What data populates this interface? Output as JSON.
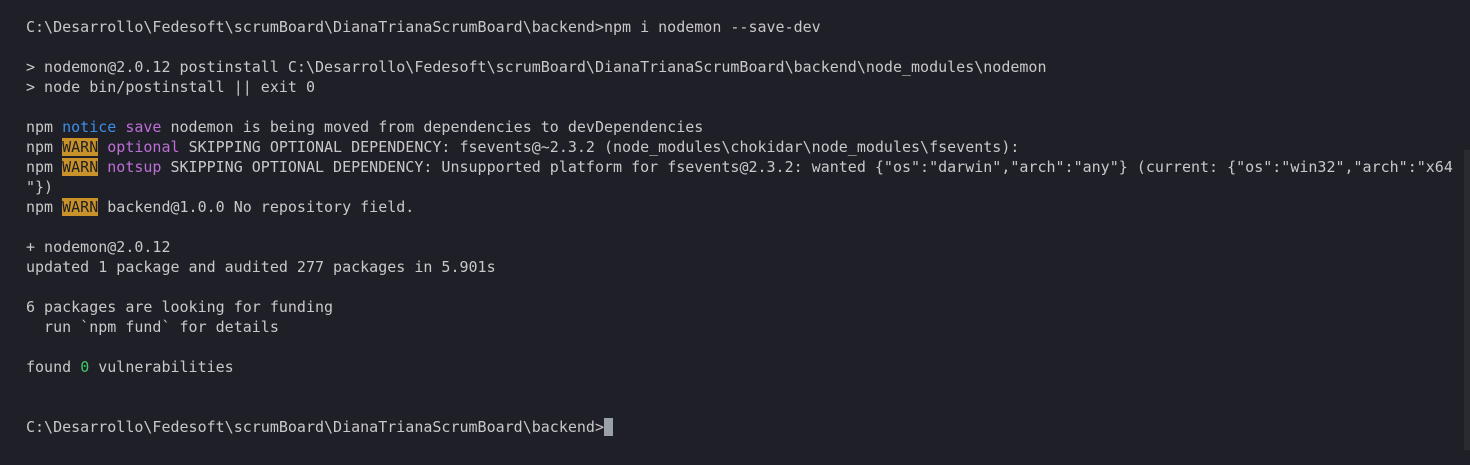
{
  "terminal": {
    "prompt_path": "C:\\Desarrollo\\Fedesoft\\scrumBoard\\DianaTrianaScrumBoard\\backend>",
    "command": "npm i nodemon --save-dev",
    "postinstall_line": "> nodemon@2.0.12 postinstall C:\\Desarrollo\\Fedesoft\\scrumBoard\\DianaTrianaScrumBoard\\backend\\node_modules\\nodemon",
    "node_line": "> node bin/postinstall || exit 0",
    "npm_prefix": "npm",
    "notice": {
      "tag": "notice",
      "kind": "save",
      "message": "nodemon is being moved from dependencies to devDependencies"
    },
    "warn_optional": {
      "tag": "WARN",
      "kind": "optional",
      "message": "SKIPPING OPTIONAL DEPENDENCY: fsevents@~2.3.2 (node_modules\\chokidar\\node_modules\\fsevents):"
    },
    "warn_notsup": {
      "tag": "WARN",
      "kind": "notsup",
      "message": "SKIPPING OPTIONAL DEPENDENCY: Unsupported platform for fsevents@2.3.2: wanted {\"os\":\"darwin\",\"arch\":\"any\"} (current: {\"os\":\"win32\",\"arch\":\"x64",
      "continuation": "\"})"
    },
    "warn_repo": {
      "tag": "WARN",
      "message": "backend@1.0.0 No repository field."
    },
    "added": "+ nodemon@2.0.12",
    "updated": "updated 1 package and audited 277 packages in 5.901s",
    "funding": "6 packages are looking for funding",
    "funding_hint": "  run `npm fund` for details",
    "found_prefix": "found",
    "vuln_count": "0",
    "found_suffix": "vulnerabilities"
  },
  "colors": {
    "background": "#1f2027",
    "text": "#c8c8c8",
    "notice": "#3b8eea",
    "magenta": "#bc6ed6",
    "warn_badge": "#c9912a",
    "success": "#3fc968"
  }
}
